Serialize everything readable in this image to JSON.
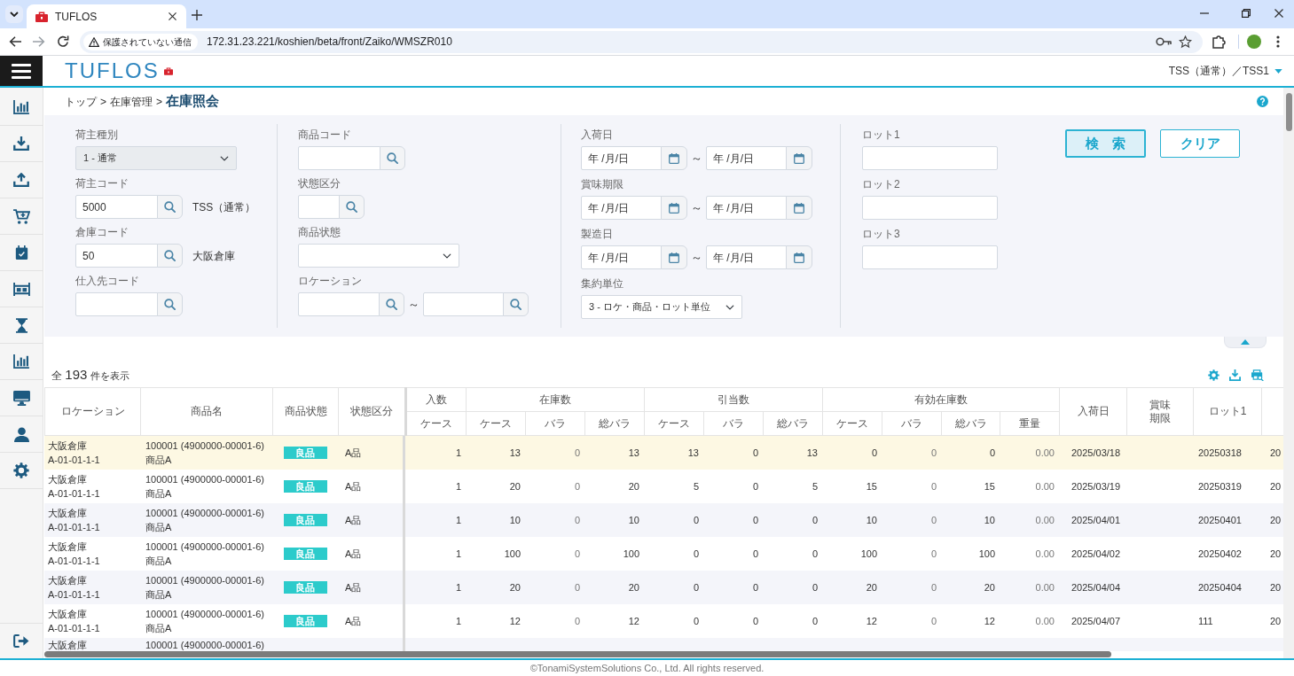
{
  "browser": {
    "tab_title": "TUFLOS",
    "security_label": "保護されていない通信",
    "url": "172.31.23.221/koshien/beta/front/Zaiko/WMSZR010"
  },
  "header": {
    "logo": "TUFLOS",
    "user": "TSS（通常）／TSS1"
  },
  "breadcrumb": {
    "items": [
      {
        "label": "トップ",
        "current": false
      },
      {
        "label": "在庫管理",
        "current": false
      },
      {
        "label": "在庫照会",
        "current": true
      }
    ],
    "separators": [
      ">",
      ">"
    ]
  },
  "search": {
    "groups": [
      [
        {
          "kind": "select",
          "label": "荷主種別",
          "value": "1 - 通常",
          "disabled": true
        },
        {
          "kind": "lookup",
          "label": "荷主コード",
          "value": "5000",
          "name": "TSS（通常）",
          "disabled": false
        },
        {
          "kind": "lookup",
          "label": "倉庫コード",
          "value": "50",
          "name": "大阪倉庫",
          "disabled": false
        },
        {
          "kind": "lookup",
          "label": "仕入先コード",
          "disabled": false
        }
      ],
      [
        {
          "kind": "lookup",
          "label": "商品コード",
          "disabled": false
        },
        {
          "kind": "lookup",
          "label": "状態区分",
          "disabled": false
        },
        {
          "kind": "select",
          "label": "商品状態",
          "disabled": false
        },
        {
          "kind": "lookup_range",
          "label": "ロケーション",
          "separator": "～",
          "disabled": false
        }
      ],
      [
        {
          "kind": "date_range",
          "label": "入荷日",
          "from": {
            "placeholder": "年 /月/日"
          },
          "separator": "～",
          "to": {
            "placeholder": "年 /月/日"
          },
          "disabled": false
        },
        {
          "kind": "date_range",
          "label": "賞味期限",
          "from": {
            "placeholder": "年 /月/日"
          },
          "separator": "～",
          "to": {
            "placeholder": "年 /月/日"
          },
          "disabled": false
        },
        {
          "kind": "date_range",
          "label": "製造日",
          "from": {
            "placeholder": "年 /月/日"
          },
          "separator": "～",
          "to": {
            "placeholder": "年 /月/日"
          },
          "disabled": false
        },
        {
          "kind": "select",
          "label": "集約単位",
          "value": "3 - ロケ・商品・ロット単位",
          "disabled": false
        }
      ],
      [
        {
          "kind": "text",
          "label": "ロット1",
          "disabled": false
        },
        {
          "kind": "text",
          "label": "ロット2",
          "disabled": false
        },
        {
          "kind": "text",
          "label": "ロット3",
          "disabled": false
        }
      ]
    ],
    "buttons": [
      {
        "label": "検　索",
        "kind": "primary"
      },
      {
        "label": "クリア",
        "kind": "outline"
      }
    ]
  },
  "results": {
    "prefix": "全",
    "count": "193",
    "suffix": "件を表示"
  },
  "table": {
    "columns": [
      {
        "label": "ロケーション"
      },
      {
        "label": "商品名"
      },
      {
        "label": "商品状態"
      },
      {
        "label": "状態区分"
      },
      {
        "label": "入数",
        "sub": [
          "ケース"
        ]
      },
      {
        "label": "在庫数",
        "sub": [
          "ケース",
          "バラ",
          "総バラ"
        ]
      },
      {
        "label": "引当数",
        "sub": [
          "ケース",
          "バラ",
          "総バラ"
        ]
      },
      {
        "label": "有効在庫数",
        "sub": [
          "ケース",
          "バラ",
          "総バラ",
          "重量"
        ]
      },
      {
        "label": "入荷日"
      },
      {
        "label": "賞味期限"
      },
      {
        "label": "ロット1"
      }
    ],
    "rows": [
      {
        "selected": true,
        "warehouse": "大阪倉庫",
        "location": "A-01-01-1-1",
        "product_code": "100001 (4900000-00001-6)",
        "product_name": "商品A",
        "condition": "良品",
        "grade": "A品",
        "per_case": "1",
        "stock": [
          "13",
          "0",
          "13"
        ],
        "allocated": [
          "13",
          "0",
          "13"
        ],
        "available": [
          "0",
          "0",
          "0",
          "0.00"
        ],
        "arrival_date": "2025/03/18",
        "lot1": "20250318",
        "column_19": "20"
      },
      {
        "selected": false,
        "warehouse": "大阪倉庫",
        "location": "A-01-01-1-1",
        "product_code": "100001 (4900000-00001-6)",
        "product_name": "商品A",
        "condition": "良品",
        "grade": "A品",
        "per_case": "1",
        "stock": [
          "20",
          "0",
          "20"
        ],
        "allocated": [
          "5",
          "0",
          "5"
        ],
        "available": [
          "15",
          "0",
          "15",
          "0.00"
        ],
        "arrival_date": "2025/03/19",
        "lot1": "20250319",
        "column_19": "20"
      },
      {
        "selected": false,
        "warehouse": "大阪倉庫",
        "location": "A-01-01-1-1",
        "product_code": "100001 (4900000-00001-6)",
        "product_name": "商品A",
        "condition": "良品",
        "grade": "A品",
        "per_case": "1",
        "stock": [
          "10",
          "0",
          "10"
        ],
        "allocated": [
          "0",
          "0",
          "0"
        ],
        "available": [
          "10",
          "0",
          "10",
          "0.00"
        ],
        "arrival_date": "2025/04/01",
        "lot1": "20250401",
        "column_19": "20"
      },
      {
        "selected": false,
        "warehouse": "大阪倉庫",
        "location": "A-01-01-1-1",
        "product_code": "100001 (4900000-00001-6)",
        "product_name": "商品A",
        "condition": "良品",
        "grade": "A品",
        "per_case": "1",
        "stock": [
          "100",
          "0",
          "100"
        ],
        "allocated": [
          "0",
          "0",
          "0"
        ],
        "available": [
          "100",
          "0",
          "100",
          "0.00"
        ],
        "arrival_date": "2025/04/02",
        "lot1": "20250402",
        "column_19": "20"
      },
      {
        "selected": false,
        "warehouse": "大阪倉庫",
        "location": "A-01-01-1-1",
        "product_code": "100001 (4900000-00001-6)",
        "product_name": "商品A",
        "condition": "良品",
        "grade": "A品",
        "per_case": "1",
        "stock": [
          "20",
          "0",
          "20"
        ],
        "allocated": [
          "0",
          "0",
          "0"
        ],
        "available": [
          "20",
          "0",
          "20",
          "0.00"
        ],
        "arrival_date": "2025/04/04",
        "lot1": "20250404",
        "column_19": "20"
      },
      {
        "selected": false,
        "warehouse": "大阪倉庫",
        "location": "A-01-01-1-1",
        "product_code": "100001 (4900000-00001-6)",
        "product_name": "商品A",
        "condition": "良品",
        "grade": "A品",
        "per_case": "1",
        "stock": [
          "12",
          "0",
          "12"
        ],
        "allocated": [
          "0",
          "0",
          "0"
        ],
        "available": [
          "12",
          "0",
          "12",
          "0.00"
        ],
        "arrival_date": "2025/04/07",
        "lot1": "111",
        "column_19": "20"
      },
      {
        "selected": false,
        "warehouse": "大阪倉庫",
        "product_code": "100001 (4900000-00001-6)"
      }
    ]
  },
  "footer": {
    "copyright": "©TonamiSystemSolutions Co., Ltd. All rights reserved."
  }
}
